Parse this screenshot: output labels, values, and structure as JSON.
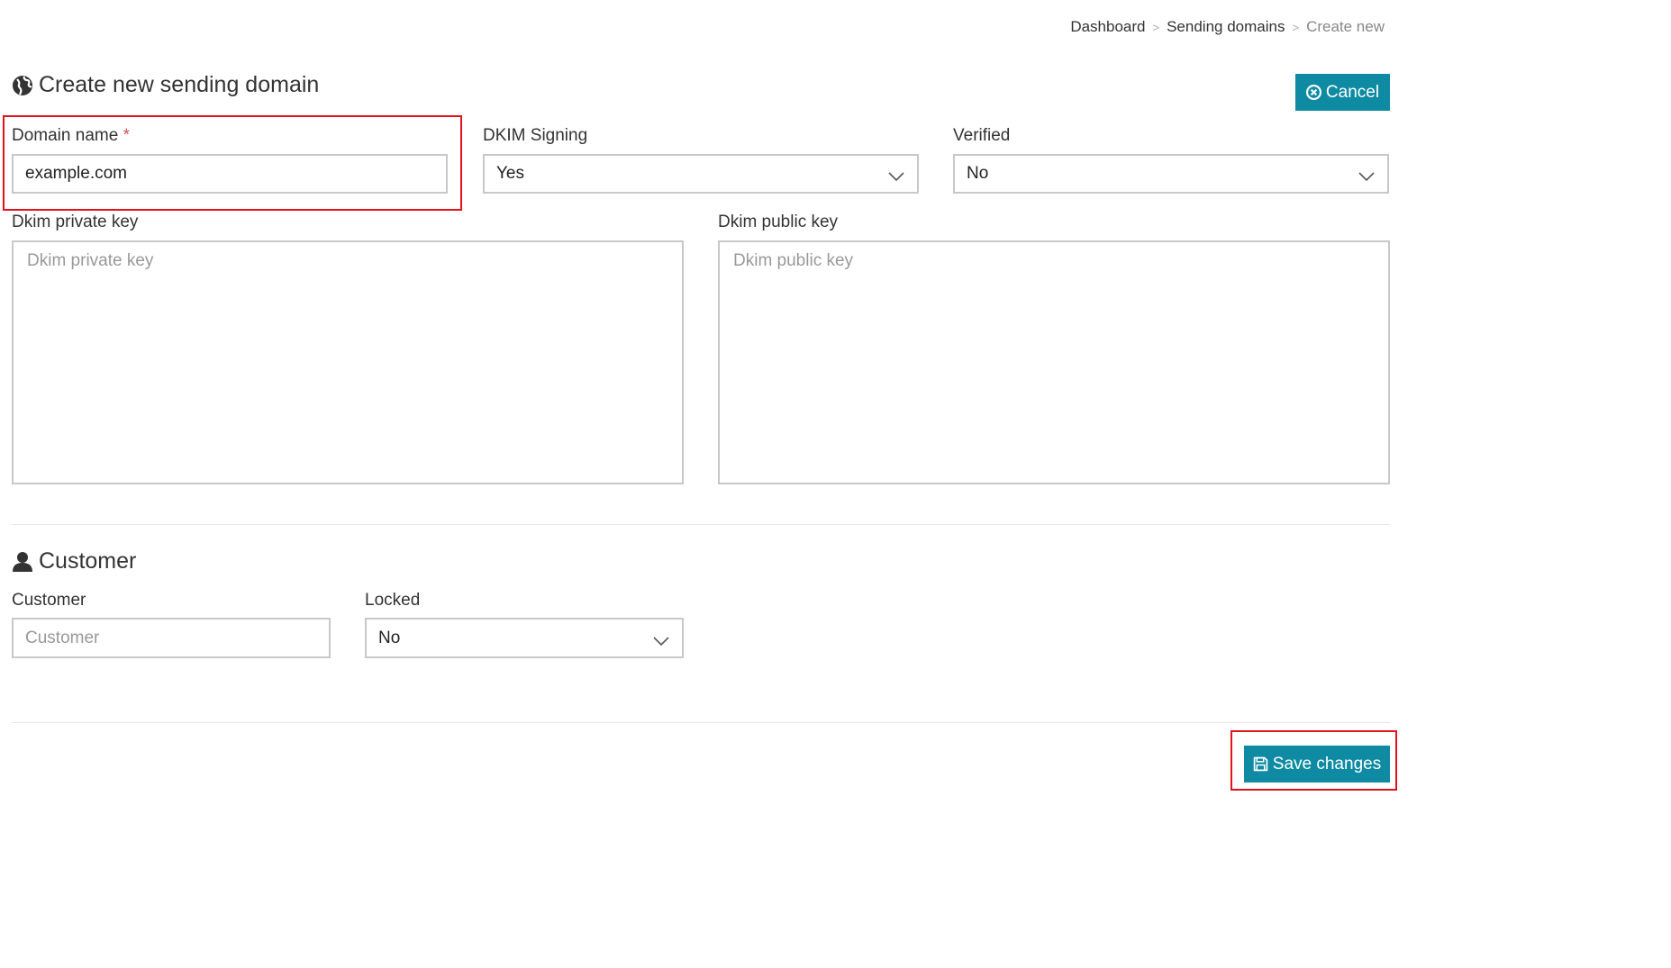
{
  "breadcrumb": {
    "items": [
      "Dashboard",
      "Sending domains"
    ],
    "separator": ">",
    "current": "Create new"
  },
  "domain_section": {
    "title": "Create new sending domain",
    "icon": "globe-icon",
    "cancel_label": "Cancel",
    "cancel_icon": "times-circle-icon",
    "domain_name": {
      "label": "Domain name",
      "required_mark": "*",
      "value": "example.com"
    },
    "dkim_signing": {
      "label": "DKIM Signing",
      "value": "Yes"
    },
    "verified": {
      "label": "Verified",
      "value": "No"
    },
    "dkim_private_key": {
      "label": "Dkim private key",
      "placeholder": "Dkim private key"
    },
    "dkim_public_key": {
      "label": "Dkim public key",
      "placeholder": "Dkim public key"
    }
  },
  "customer_section": {
    "title": "Customer",
    "icon": "user-icon",
    "customer": {
      "label": "Customer",
      "placeholder": "Customer"
    },
    "locked": {
      "label": "Locked",
      "value": "No"
    }
  },
  "footer": {
    "save_label": "Save changes",
    "save_icon": "floppy-disk-icon"
  },
  "colors": {
    "accent": "#0e8ba3",
    "highlight": "#e0121e",
    "required": "#d9534f",
    "border": "#c8c8c8"
  }
}
